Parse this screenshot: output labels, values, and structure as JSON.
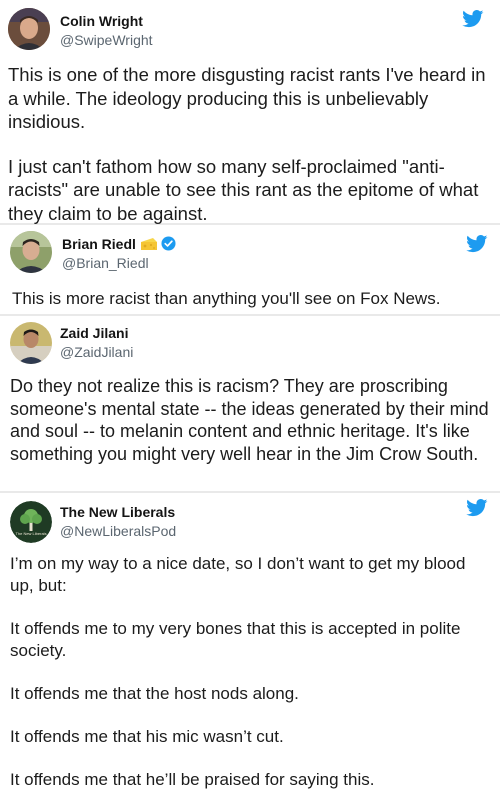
{
  "tweets": [
    {
      "name": "Colin Wright",
      "handle": "@SwipeWright",
      "avatar": "person-photo",
      "paragraphs": [
        "This is one of the more disgusting racist rants I've heard in a while. The ideology producing this is unbelievably insidious.",
        "I just can't fathom how so many self-proclaimed \"anti-racists\" are unable to see this rant as the epitome of what they claim to be against."
      ]
    },
    {
      "name": "Brian Riedl",
      "handle": "@Brian_Riedl",
      "avatar": "person-photo",
      "badges": [
        "cheese-emoji-icon",
        "verified-badge-icon"
      ],
      "paragraphs": [
        "This is more racist than anything you'll see on Fox News."
      ]
    },
    {
      "name": "Zaid Jilani",
      "handle": "@ZaidJilani",
      "avatar": "person-photo",
      "paragraphs": [
        "Do they not realize this is racism? They are proscribing someone's mental state -- the ideas generated by their mind and soul -- to melanin content and ethnic heritage. It's like something you might very well hear in the Jim Crow South."
      ]
    },
    {
      "name": "The New Liberals",
      "handle": "@NewLiberalsPod",
      "avatar": "tree-logo",
      "avatar_caption": "The New Liberals",
      "paragraphs": [
        "I’m on my way to a nice date, so I don’t want to get my blood up, but:",
        "It offends me to my very bones that this is accepted in polite society.",
        "It offends me that the host nods along.",
        "It offends me that his mic wasn’t cut.",
        "It offends me that he’ll be praised for saying this."
      ]
    }
  ],
  "colors": {
    "twitter_blue": "#1d9bf0",
    "verified_blue": "#1d9bf0"
  },
  "icons": [
    "twitter-bird-icon",
    "verified-badge-icon",
    "cheese-emoji-icon"
  ]
}
